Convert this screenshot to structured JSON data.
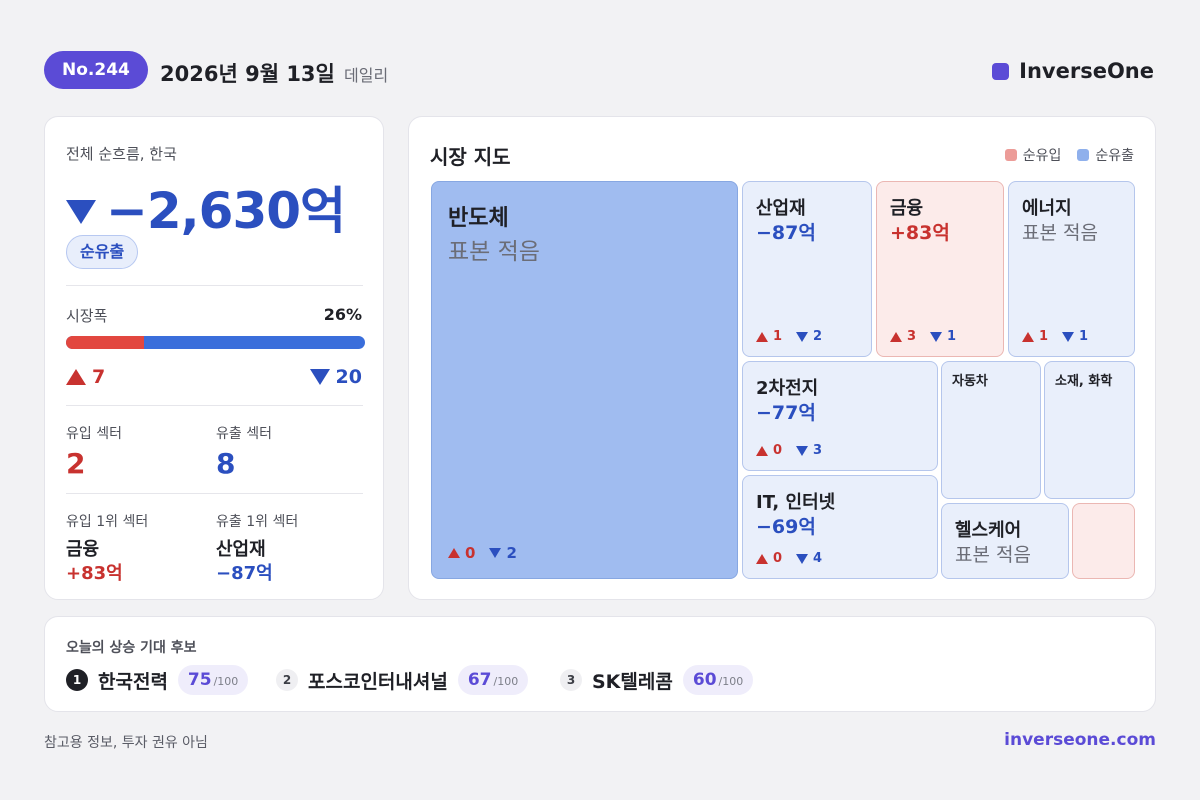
{
  "header": {
    "issue": "No.244",
    "date": "2026년 9월 13일",
    "edition": "데일리",
    "brand": "InverseOne"
  },
  "summary": {
    "label": "전체 순흐름, 한국",
    "total": "−2,630억",
    "status": "순유출",
    "breadth_label": "시장폭",
    "breadth_pct": "26%",
    "breadth_fraction": 0.26,
    "up_count": "7",
    "down_count": "20",
    "inflow_sectors_label": "유입 섹터",
    "inflow_sectors": "2",
    "outflow_sectors_label": "유출 섹터",
    "outflow_sectors": "8",
    "top_inflow_label": "유입 1위 섹터",
    "top_inflow_name": "금융",
    "top_inflow_value": "+83억",
    "top_outflow_label": "유출 1위 섹터",
    "top_outflow_name": "산업재",
    "top_outflow_value": "−87억"
  },
  "market_map": {
    "title": "시장 지도",
    "legend_inflow": "순유입",
    "legend_outflow": "순유출",
    "tiles": {
      "semis": {
        "name": "반도체",
        "value": "표본 적음",
        "up": "0",
        "down": "2"
      },
      "industrials": {
        "name": "산업재",
        "value": "−87억",
        "up": "1",
        "down": "2"
      },
      "finance": {
        "name": "금융",
        "value": "+83억",
        "up": "3",
        "down": "1"
      },
      "energy": {
        "name": "에너지",
        "value": "표본 적음",
        "up": "1",
        "down": "1"
      },
      "battery": {
        "name": "2차전지",
        "value": "−77억",
        "up": "0",
        "down": "3"
      },
      "auto": {
        "name": "자동차"
      },
      "materials": {
        "name": "소재, 화학"
      },
      "it": {
        "name": "IT, 인터넷",
        "value": "−69억",
        "up": "0",
        "down": "4"
      },
      "health": {
        "name": "헬스케어",
        "value": "표본 적음"
      }
    }
  },
  "picks": {
    "title": "오늘의 상승 기대 후보",
    "items": [
      {
        "rank": "1",
        "name": "한국전력",
        "score": "75",
        "max": "/100"
      },
      {
        "rank": "2",
        "name": "포스코인터내셔널",
        "score": "67",
        "max": "/100"
      },
      {
        "rank": "3",
        "name": "SK텔레콤",
        "score": "60",
        "max": "/100"
      }
    ]
  },
  "footer": {
    "note": "참고용 정보, 투자 권유 아님",
    "link": "inverseone.com"
  },
  "colors": {
    "brand": "#5b4bd6",
    "inflow": "#c8322f",
    "outflow": "#2b4fbf"
  }
}
